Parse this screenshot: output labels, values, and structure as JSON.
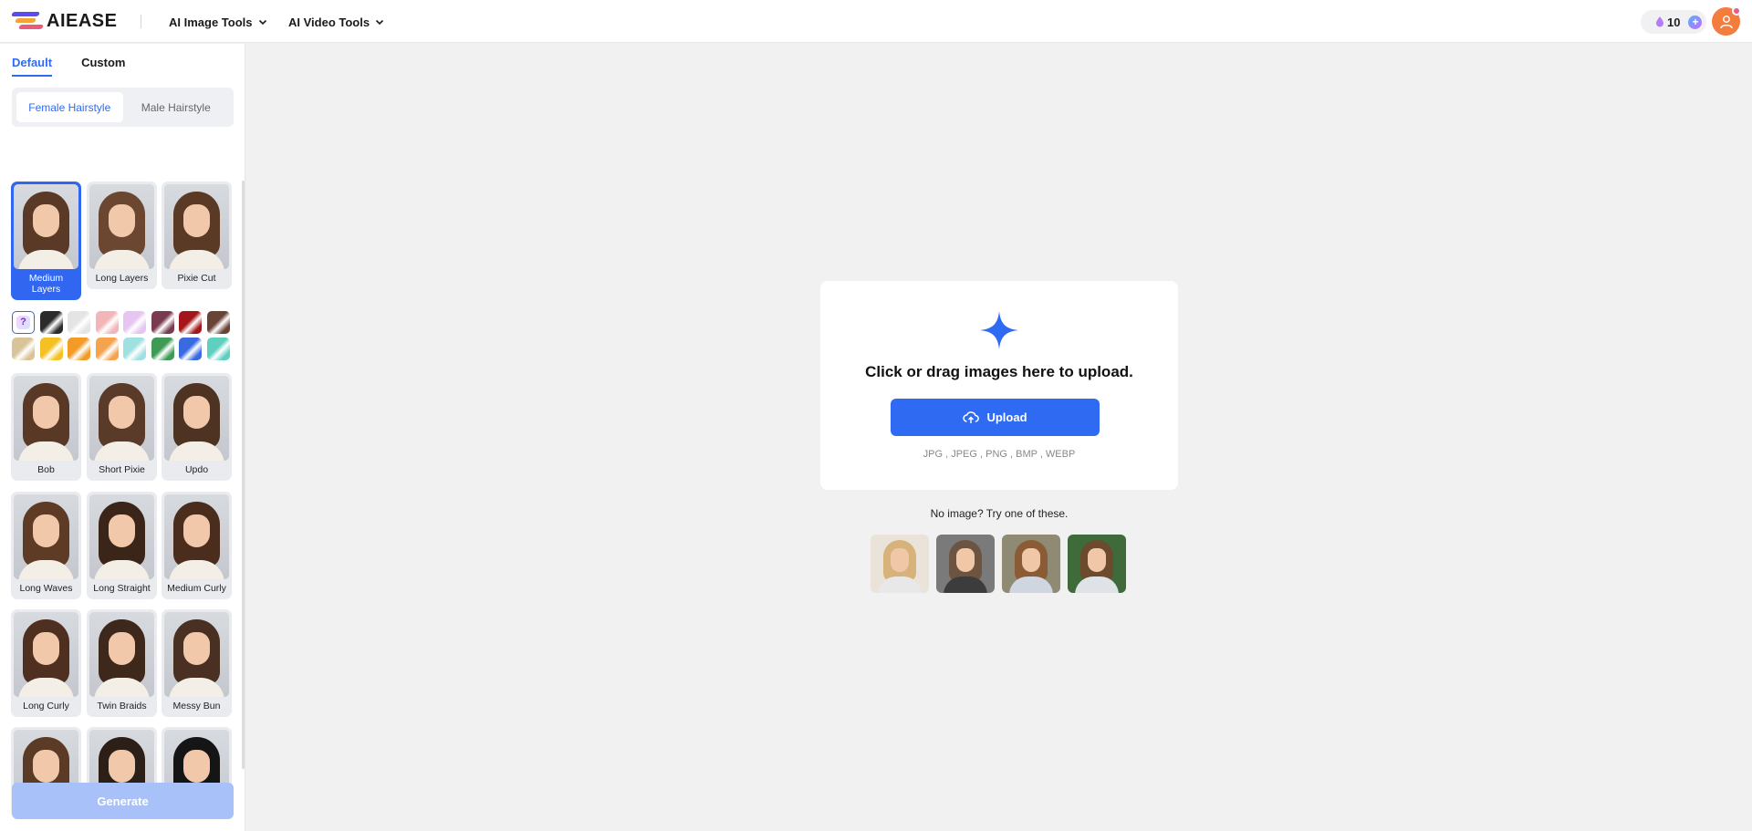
{
  "header": {
    "logo_text": "AIEASE",
    "nav": [
      {
        "label": "AI Image Tools"
      },
      {
        "label": "AI Video Tools"
      }
    ],
    "credits": "10"
  },
  "sidebar": {
    "tabs": [
      {
        "label": "Default"
      },
      {
        "label": "Custom"
      }
    ],
    "gender": [
      {
        "label": "Female Hairstyle"
      },
      {
        "label": "Male Hairstyle"
      }
    ],
    "top_styles": [
      {
        "label": "Medium Layers",
        "hair": "#5a3a26"
      },
      {
        "label": "Long Layers",
        "hair": "#6b4630"
      },
      {
        "label": "Pixie Cut",
        "hair": "#5b3a25"
      }
    ],
    "swatch_colors": [
      "#2b2b2b",
      "#e4e4e4",
      "#f3b6b8",
      "#e6c5f0",
      "#7a3a50",
      "#a4161c",
      "#6a4337",
      "#d9c49a",
      "#f5c023",
      "#f39a27",
      "#f5a34c",
      "#9fe0e0",
      "#3f9a55",
      "#3a6ae0",
      "#5fd0c0"
    ],
    "styles": [
      {
        "label": "Bob",
        "hair": "#5a3826"
      },
      {
        "label": "Short Pixie",
        "hair": "#5a3a28"
      },
      {
        "label": "Updo",
        "hair": "#4e3222"
      },
      {
        "label": "Long Waves",
        "hair": "#5e3b24"
      },
      {
        "label": "Long Straight",
        "hair": "#3b2519"
      },
      {
        "label": "Medium Curly",
        "hair": "#4a2d1d"
      },
      {
        "label": "Long Curly",
        "hair": "#4f3020"
      },
      {
        "label": "Twin Braids",
        "hair": "#3e271b"
      },
      {
        "label": "Messy Bun",
        "hair": "#4a3022"
      },
      {
        "label": "",
        "hair": "#5b3a26"
      },
      {
        "label": "",
        "hair": "#2b1f18"
      },
      {
        "label": "",
        "hair": "#151515"
      }
    ],
    "generate_label": "Generate"
  },
  "upload": {
    "title": "Click or drag images here to upload.",
    "button_label": "Upload",
    "formats": "JPG , JPEG , PNG , BMP , WEBP",
    "try_label": "No image? Try one of these."
  },
  "samples": [
    {
      "hair": "#d7b27a",
      "bg": "#e9e3da",
      "shirt": "#e8e8e8"
    },
    {
      "hair": "#6d5440",
      "bg": "#7a7a7a",
      "shirt": "#3c3c3c"
    },
    {
      "hair": "#8a5b34",
      "bg": "#8f8a73",
      "shirt": "#cfd6df"
    },
    {
      "hair": "#6b4a2e",
      "bg": "#3f6b3a",
      "shirt": "#dfe3e8"
    }
  ]
}
